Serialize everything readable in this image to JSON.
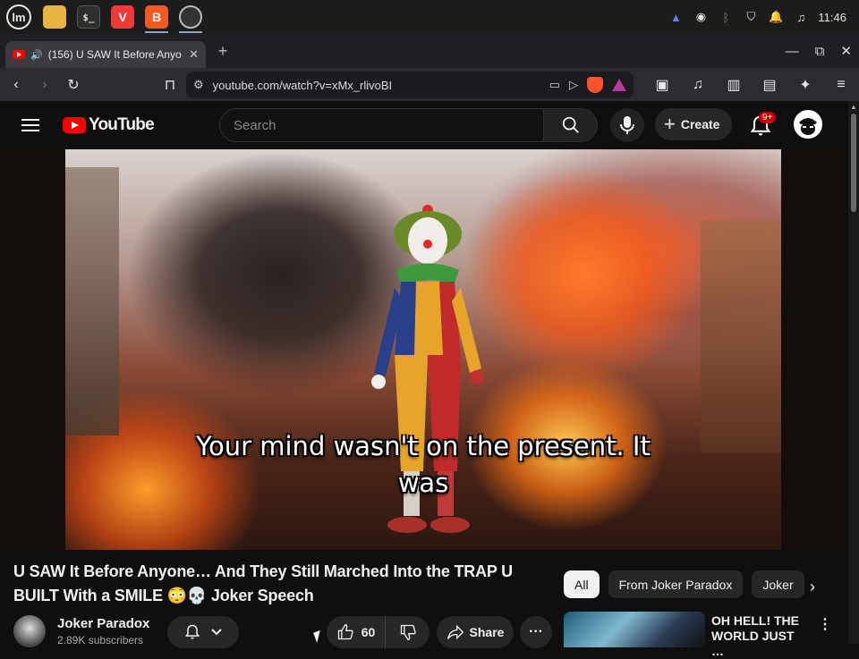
{
  "os_panel": {
    "tasks": [
      {
        "name": "files",
        "glyph": ""
      },
      {
        "name": "terminal",
        "glyph": "$_"
      },
      {
        "name": "vivaldi",
        "glyph": "V"
      },
      {
        "name": "brave",
        "glyph": "B"
      },
      {
        "name": "obs",
        "glyph": ""
      }
    ],
    "clock": "11:46"
  },
  "browser": {
    "tab": {
      "title": "(156) U SAW It Before Anyo",
      "close": "✕"
    },
    "new_tab": "+",
    "window_controls": {
      "minimize": "—",
      "restore": "⧉",
      "close": "✕"
    },
    "url": "youtube.com/watch?v=xMx_rlivoBI"
  },
  "youtube": {
    "logo_text": "YouTube",
    "search_placeholder": "Search",
    "create_label": "Create",
    "notifications_badge": "9+"
  },
  "video": {
    "subtitle_line1": "Your mind wasn't on the present. It",
    "subtitle_line2": "was",
    "title_line1": "U SAW It Before Anyone… And They Still Marched Into the TRAP U",
    "title_line2": "BUILT With a SMILE 😳💀 Joker Speech",
    "channel_name": "Joker Paradox",
    "subscribers": "2.89K subscribers",
    "likes": "60",
    "share_label": "Share"
  },
  "sidebar": {
    "chips": [
      {
        "label": "All",
        "active": true
      },
      {
        "label": "From Joker Paradox",
        "active": false
      },
      {
        "label": "Joker",
        "active": false
      }
    ],
    "recommendation": {
      "title": "OH HELL! THE WORLD JUST …"
    }
  }
}
